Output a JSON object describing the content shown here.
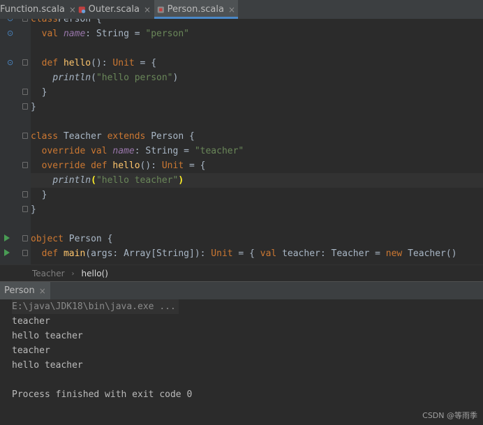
{
  "tabs": [
    {
      "label": "Function.scala",
      "close": "×",
      "icon": "scala-file-icon"
    },
    {
      "label": "Outer.scala",
      "close": "×",
      "icon": "scala-object-file-icon"
    },
    {
      "label": "Person.scala",
      "close": "×",
      "icon": "scala-class-file-icon",
      "active": true
    }
  ],
  "code": [
    {
      "tokens": [
        [
          "kw",
          "class"
        ],
        [
          "",
          "Person {"
        ]
      ]
    },
    {
      "tokens": [
        [
          "",
          "  "
        ],
        [
          "kw",
          "val "
        ],
        [
          "field",
          "name"
        ],
        [
          "",
          ": String = "
        ],
        [
          "str",
          "\"person\""
        ]
      ]
    },
    {
      "tokens": []
    },
    {
      "tokens": [
        [
          "",
          "  "
        ],
        [
          "kw",
          "def "
        ],
        [
          "fn",
          "hello"
        ],
        [
          "",
          "(): "
        ],
        [
          "kw",
          "Unit"
        ],
        [
          "",
          " = {"
        ]
      ]
    },
    {
      "tokens": [
        [
          "",
          "    "
        ],
        [
          "italic",
          "println"
        ],
        [
          "",
          "("
        ],
        [
          "str",
          "\"hello person\""
        ],
        [
          "",
          ")"
        ]
      ]
    },
    {
      "tokens": [
        [
          "",
          "  }"
        ]
      ]
    },
    {
      "tokens": [
        [
          "",
          "}"
        ]
      ]
    },
    {
      "tokens": []
    },
    {
      "tokens": [
        [
          "kw",
          "class "
        ],
        [
          "",
          "Teacher "
        ],
        [
          "kw",
          "extends "
        ],
        [
          "",
          "Person {"
        ]
      ]
    },
    {
      "tokens": [
        [
          "",
          "  "
        ],
        [
          "kw",
          "override val "
        ],
        [
          "field",
          "name"
        ],
        [
          "",
          ": String = "
        ],
        [
          "str",
          "\"teacher\""
        ]
      ]
    },
    {
      "tokens": [
        [
          "",
          "  "
        ],
        [
          "kw",
          "override def "
        ],
        [
          "fn",
          "hello"
        ],
        [
          "",
          "(): "
        ],
        [
          "kw",
          "Unit"
        ],
        [
          "",
          " = {"
        ]
      ]
    },
    {
      "tokens": [
        [
          "",
          "    "
        ],
        [
          "italic",
          "println"
        ],
        [
          "brace-hl",
          "("
        ],
        [
          "str",
          "\"hello teacher\""
        ],
        [
          "brace-hl",
          ")"
        ]
      ],
      "current": true
    },
    {
      "tokens": [
        [
          "",
          "  }"
        ]
      ]
    },
    {
      "tokens": [
        [
          "",
          "}"
        ]
      ]
    },
    {
      "tokens": []
    },
    {
      "tokens": [
        [
          "kw",
          "object "
        ],
        [
          "",
          "Person {"
        ]
      ]
    },
    {
      "tokens": [
        [
          "",
          "  "
        ],
        [
          "kw",
          "def "
        ],
        [
          "fn",
          "main"
        ],
        [
          "",
          "(args: Array[String]): "
        ],
        [
          "kw",
          "Unit"
        ],
        [
          "",
          " = { "
        ],
        [
          "kw",
          "val "
        ],
        [
          "",
          "teacher: Teacher = "
        ],
        [
          "kw",
          "new "
        ],
        [
          "",
          "Teacher()"
        ]
      ]
    }
  ],
  "breadcrumb": [
    "Teacher",
    "hello()"
  ],
  "run": {
    "tab_label": "Person",
    "tab_close": "×",
    "console": [
      "E:\\java\\JDK18\\bin\\java.exe ...",
      "teacher",
      "hello teacher",
      "teacher",
      "hello teacher",
      "",
      "Process finished with exit code 0"
    ]
  },
  "watermark": "CSDN @等雨季"
}
